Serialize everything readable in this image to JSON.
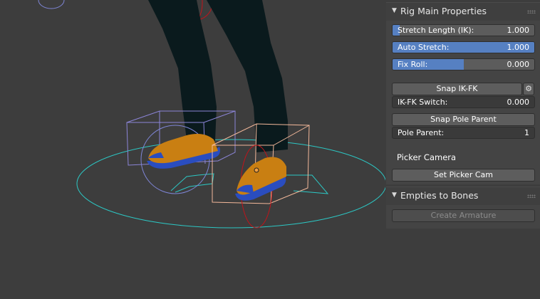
{
  "viewport": {
    "colors": {
      "background": "#3d3d3d",
      "pants": "#0a1a1d",
      "shoe_upper": "#c97f12",
      "shoe_sole": "#2a4dbf",
      "ground_circle": "#2cc7c4",
      "box_selected": "#f3b89a",
      "box_unselected": "#8c85d8",
      "rotation_circle_red": "#c0141b",
      "rotation_circle_blue": "#7f86d7"
    }
  },
  "panel": {
    "rig_main": {
      "title": "Rig Main Properties",
      "stretch_length": {
        "label": "Stretch Length (IK):",
        "value": "1.000",
        "fill": 0.05
      },
      "auto_stretch": {
        "label": "Auto Stretch:",
        "value": "1.000",
        "fill": 1.0
      },
      "fix_roll": {
        "label": "Fix Roll:",
        "value": "0.000",
        "fill": 0.5
      },
      "snap_ikfk": {
        "label": "Snap IK-FK"
      },
      "ikfk_switch": {
        "label": "IK-FK Switch:",
        "value": "0.000"
      },
      "snap_pole_parent": {
        "label": "Snap Pole Parent"
      },
      "pole_parent": {
        "label": "Pole Parent:",
        "value": "1"
      },
      "picker_camera_label": "Picker Camera",
      "set_picker_cam": {
        "label": "Set Picker Cam"
      }
    },
    "empties_to_bones": {
      "title": "Empties to Bones",
      "create_armature": {
        "label": "Create Armature",
        "enabled": false
      }
    }
  }
}
